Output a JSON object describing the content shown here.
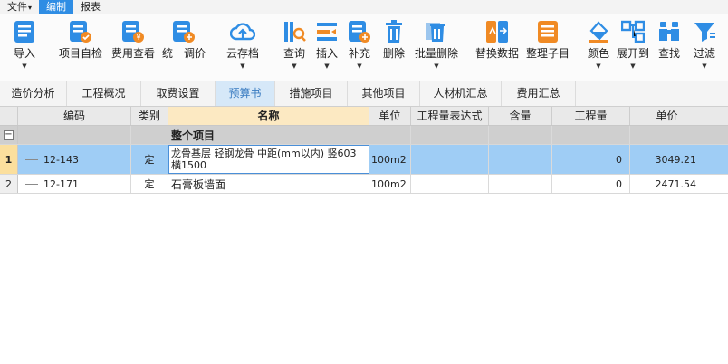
{
  "menu": {
    "file": "文件",
    "edit": "编制",
    "report": "报表"
  },
  "toolbar": [
    {
      "key": "import",
      "label": "导入",
      "icon": "import-icon",
      "has_dropdown": true
    },
    {
      "key": "self_check",
      "label": "项目自检",
      "icon": "project-check-icon",
      "has_dropdown": false
    },
    {
      "key": "fee_view",
      "label": "费用查看",
      "icon": "fee-view-icon",
      "has_dropdown": false
    },
    {
      "key": "adjust_price",
      "label": "统一调价",
      "icon": "adjust-price-icon",
      "has_dropdown": false
    },
    {
      "key": "cloud_save",
      "label": "云存档",
      "icon": "cloud-save-icon",
      "has_dropdown": true
    },
    {
      "key": "query",
      "label": "查询",
      "icon": "query-icon",
      "has_dropdown": true
    },
    {
      "key": "insert",
      "label": "插入",
      "icon": "insert-icon",
      "has_dropdown": true
    },
    {
      "key": "supplement",
      "label": "补充",
      "icon": "supplement-icon",
      "has_dropdown": true
    },
    {
      "key": "delete",
      "label": "删除",
      "icon": "delete-icon",
      "has_dropdown": false
    },
    {
      "key": "batch_delete",
      "label": "批量删除",
      "icon": "batch-delete-icon",
      "has_dropdown": true
    },
    {
      "key": "replace_data",
      "label": "替换数据",
      "icon": "replace-data-icon",
      "has_dropdown": false
    },
    {
      "key": "organize",
      "label": "整理子目",
      "icon": "organize-icon",
      "has_dropdown": false
    },
    {
      "key": "color",
      "label": "颜色",
      "icon": "color-icon",
      "has_dropdown": true
    },
    {
      "key": "expand",
      "label": "展开到",
      "icon": "expand-icon",
      "has_dropdown": true
    },
    {
      "key": "find",
      "label": "查找",
      "icon": "find-icon",
      "has_dropdown": false
    },
    {
      "key": "filter",
      "label": "过滤",
      "icon": "filter-icon",
      "has_dropdown": true
    }
  ],
  "tabs": [
    "造价分析",
    "工程概况",
    "取费设置",
    "预算书",
    "措施项目",
    "其他项目",
    "人材机汇总",
    "费用汇总"
  ],
  "active_tab": "预算书",
  "table": {
    "headers": [
      "编码",
      "类别",
      "名称",
      "单位",
      "工程量表达式",
      "含量",
      "工程量",
      "单价"
    ],
    "group_row": {
      "name": "整个项目",
      "toggle": "−"
    },
    "rows": [
      {
        "no": "1",
        "code": "12-143",
        "type": "定",
        "name": "龙骨基层 轻钢龙骨 中距(mm以内) 竖603 横1500",
        "unit": "100m2",
        "expr": "",
        "content": "",
        "quantity": "0",
        "price": "3049.21"
      },
      {
        "no": "2",
        "code": "12-171",
        "type": "定",
        "name": "石膏板墙面",
        "unit": "100m2",
        "expr": "",
        "content": "",
        "quantity": "0",
        "price": "2471.54"
      }
    ]
  },
  "colors": {
    "accent": "#2f8de4",
    "selected_row": "#9fcdf5",
    "active_tab": "#d6e8f8",
    "header_selected": "#fce9c2",
    "icon_blue": "#2f8de4",
    "icon_orange": "#f08a24"
  }
}
